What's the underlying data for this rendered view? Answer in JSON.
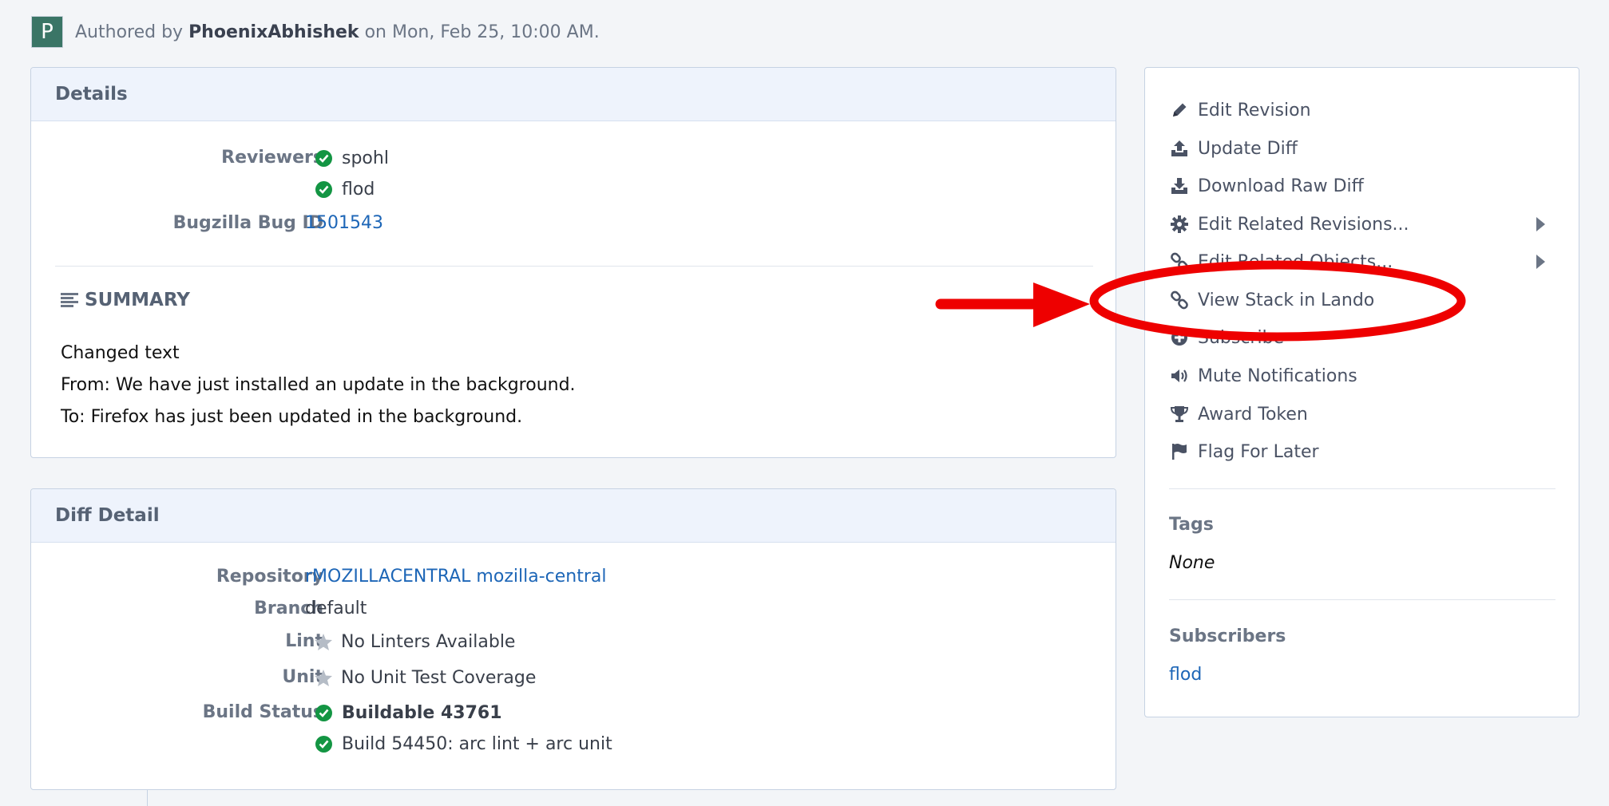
{
  "author": {
    "avatar_letter": "P",
    "prefix": "Authored by",
    "name": "PhoenixAbhishek",
    "suffix": "on Mon, Feb 25, 10:00 AM."
  },
  "details": {
    "title": "Details",
    "reviewers_label": "Reviewers",
    "reviewers": [
      "spohl",
      "flod"
    ],
    "bug_label": "Bugzilla Bug ID",
    "bug_id": "1501543",
    "summary_heading": "SUMMARY",
    "summary_lines": [
      "Changed text",
      "From: We have just installed an update in the background.",
      "To: Firefox has just been updated in the background."
    ]
  },
  "diff_detail": {
    "title": "Diff Detail",
    "repository_label": "Repository",
    "repository": "rMOZILLACENTRAL mozilla-central",
    "branch_label": "Branch",
    "branch": "default",
    "lint_label": "Lint",
    "lint": "No Linters Available",
    "unit_label": "Unit",
    "unit": "No Unit Test Coverage",
    "build_label": "Build Status",
    "build_items": [
      "Buildable 43761",
      "Build 54450: arc lint + arc unit"
    ]
  },
  "actions": {
    "items": [
      {
        "label": "Edit Revision",
        "icon": "pencil-icon"
      },
      {
        "label": "Update Diff",
        "icon": "upload-icon"
      },
      {
        "label": "Download Raw Diff",
        "icon": "download-icon"
      },
      {
        "label": "Edit Related Revisions...",
        "icon": "gear-icon"
      },
      {
        "label": "Edit Related Objects...",
        "icon": "link-icon"
      },
      {
        "label": "View Stack in Lando",
        "icon": "link-icon"
      },
      {
        "label": "Subscribe",
        "icon": "plus-circle-icon"
      },
      {
        "label": "Mute Notifications",
        "icon": "volume-icon"
      },
      {
        "label": "Award Token",
        "icon": "trophy-icon"
      },
      {
        "label": "Flag For Later",
        "icon": "flag-icon"
      }
    ],
    "tags_label": "Tags",
    "tags_value": "None",
    "subscribers_label": "Subscribers",
    "subscribers": [
      "flod"
    ]
  },
  "annotation": {
    "color": "#ee0000"
  },
  "colors": {
    "link": "#1d66b7",
    "success": "#139543",
    "header_bg": "#eef3fc"
  }
}
